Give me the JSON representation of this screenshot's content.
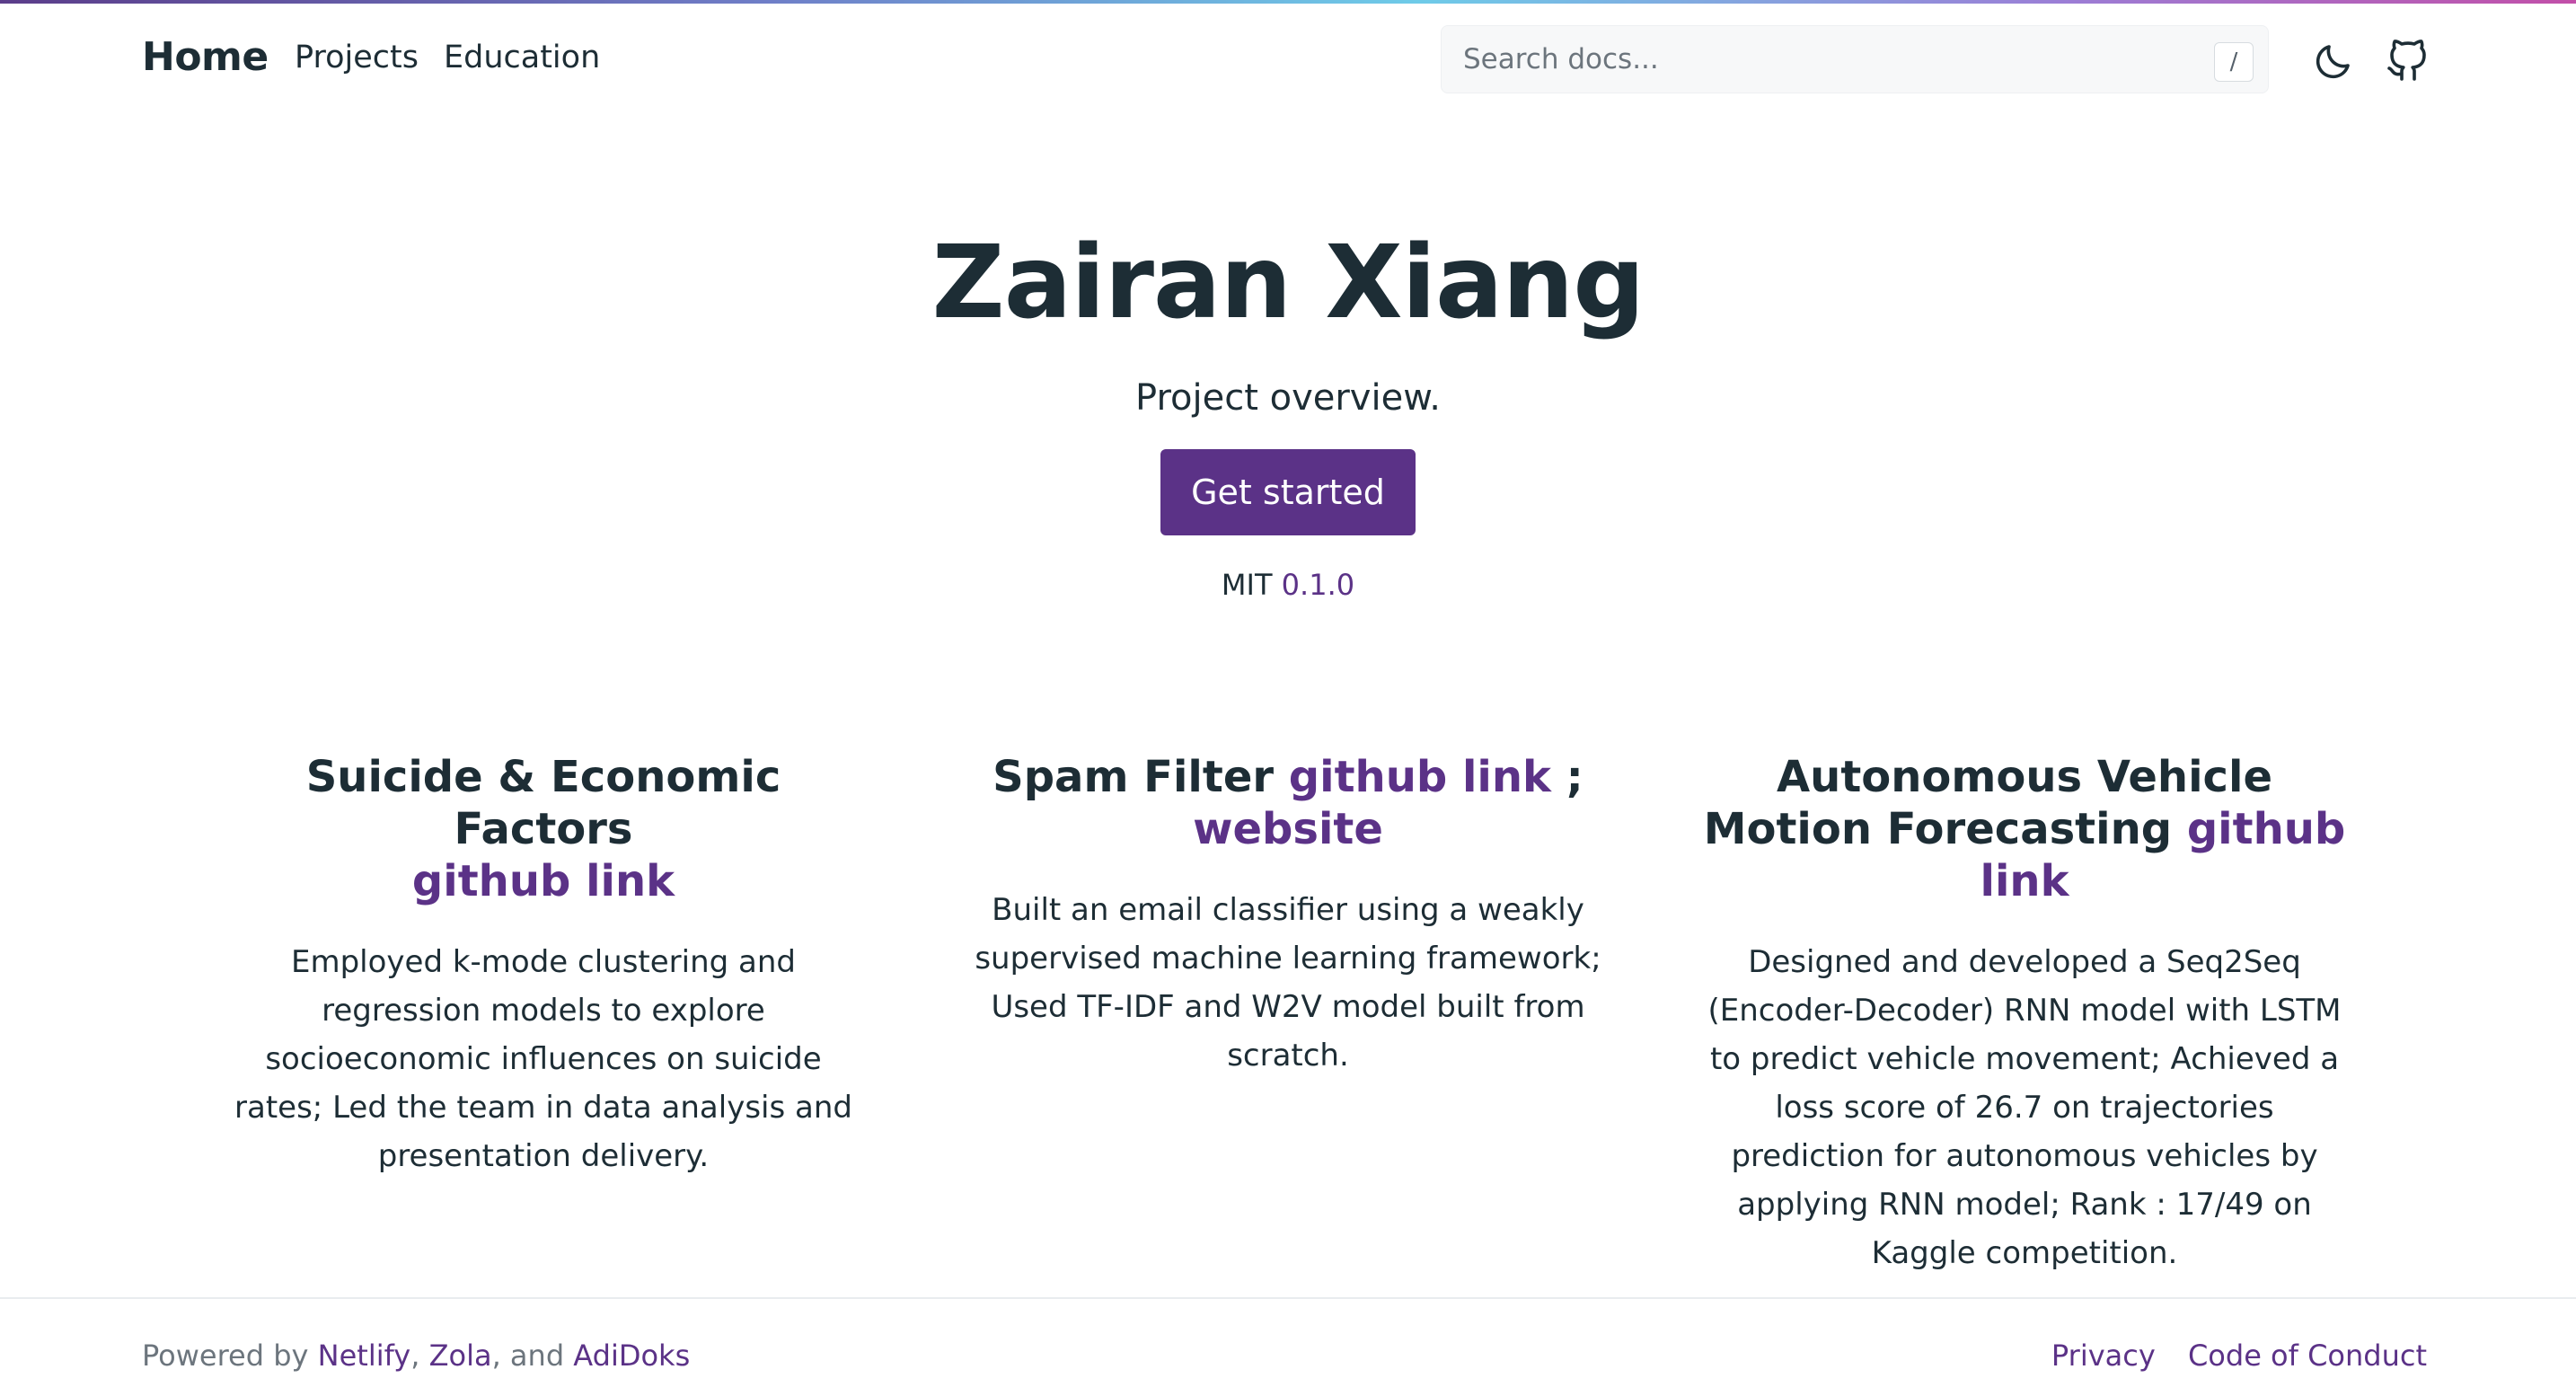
{
  "nav": {
    "brand": "Home",
    "links": [
      "Projects",
      "Education"
    ],
    "search_placeholder": "Search docs...",
    "search_shortcut": "/"
  },
  "hero": {
    "title": "Zairan Xiang",
    "lead": "Project overview.",
    "cta": "Get started",
    "license": "MIT",
    "version": "0.1.0"
  },
  "features": [
    {
      "title": "Suicide & Economic Factors",
      "link": "github link",
      "body": "Employed k-mode clustering and regression models to explore socioeconomic influences on suicide rates; Led the team in data analysis and presentation delivery."
    },
    {
      "title": "Spam Filter",
      "link": "github link",
      "separator": ";",
      "link2": "website",
      "body": "Built an email classifier using a weakly supervised machine learning framework; Used TF-IDF and W2V model built from scratch."
    },
    {
      "title": "Autonomous Vehicle Motion Forecasting",
      "link": "github link",
      "body": "Designed and developed a Seq2Seq (Encoder-Decoder) RNN model with LSTM to predict vehicle movement; Achieved a loss score of 26.7 on trajectories prediction for autonomous vehicles by applying RNN model; Rank : 17/49 on Kaggle competition."
    }
  ],
  "footer": {
    "powered_by": "Powered by",
    "netlify": "Netlify",
    "comma": ",",
    "zola": "Zola",
    "and": ", and",
    "adidoks": "AdiDoks",
    "privacy": "Privacy",
    "coc": "Code of Conduct"
  },
  "icons": [
    "moon-icon",
    "github-icon"
  ],
  "colors": {
    "accent": "#5b3287",
    "text": "#1d2d35"
  }
}
